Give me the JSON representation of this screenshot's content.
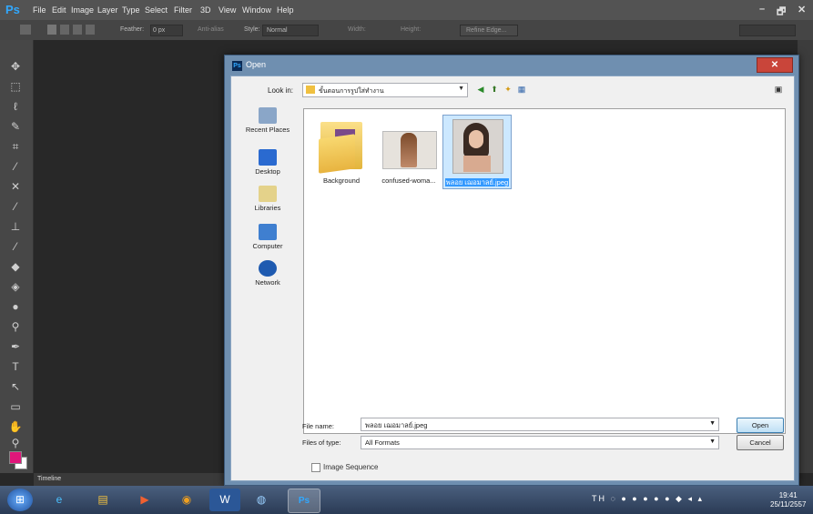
{
  "photoshop": {
    "logo": "Ps",
    "menu": [
      "File",
      "Edit",
      "Image",
      "Layer",
      "Type",
      "Select",
      "Filter",
      "3D",
      "View",
      "Window",
      "Help"
    ],
    "options": {
      "feather_label": "Feather:",
      "feather_value": "0 px",
      "antialias_label": "Anti-alias",
      "style_label": "Style:",
      "style_value": "Normal",
      "width_label": "Width:",
      "height_label": "Height:",
      "refine_label": "Refine Edge..."
    },
    "timeline_label": "Timeline",
    "window_controls": [
      "–",
      "🗗",
      "✕"
    ]
  },
  "dialog": {
    "title": "Open",
    "close_label": "✕",
    "look_in_label": "Look in:",
    "look_in_value": "ขั้นตอนการรูปใส่ทำงาน",
    "places": [
      "Recent Places",
      "Desktop",
      "Libraries",
      "Computer",
      "Network"
    ],
    "files": [
      {
        "name": "Background",
        "kind": "folder"
      },
      {
        "name": "confused-woma...",
        "kind": "image"
      },
      {
        "name": "พลอย เฌอมาลย์.jpeg",
        "kind": "image",
        "selected": true
      }
    ],
    "file_name_label": "File name:",
    "file_name_value": "พลอย เฌอมาลย์.jpeg",
    "files_of_type_label": "Files of type:",
    "files_of_type_value": "All Formats",
    "open_button": "Open",
    "cancel_button": "Cancel",
    "image_sequence_label": "Image Sequence"
  },
  "taskbar": {
    "clock_time": "19:41",
    "clock_date": "25/11/2557",
    "lang": "TH"
  },
  "colors": {
    "foreground": "#e0167a",
    "background": "#ffffff",
    "selection": "#3399ff"
  }
}
